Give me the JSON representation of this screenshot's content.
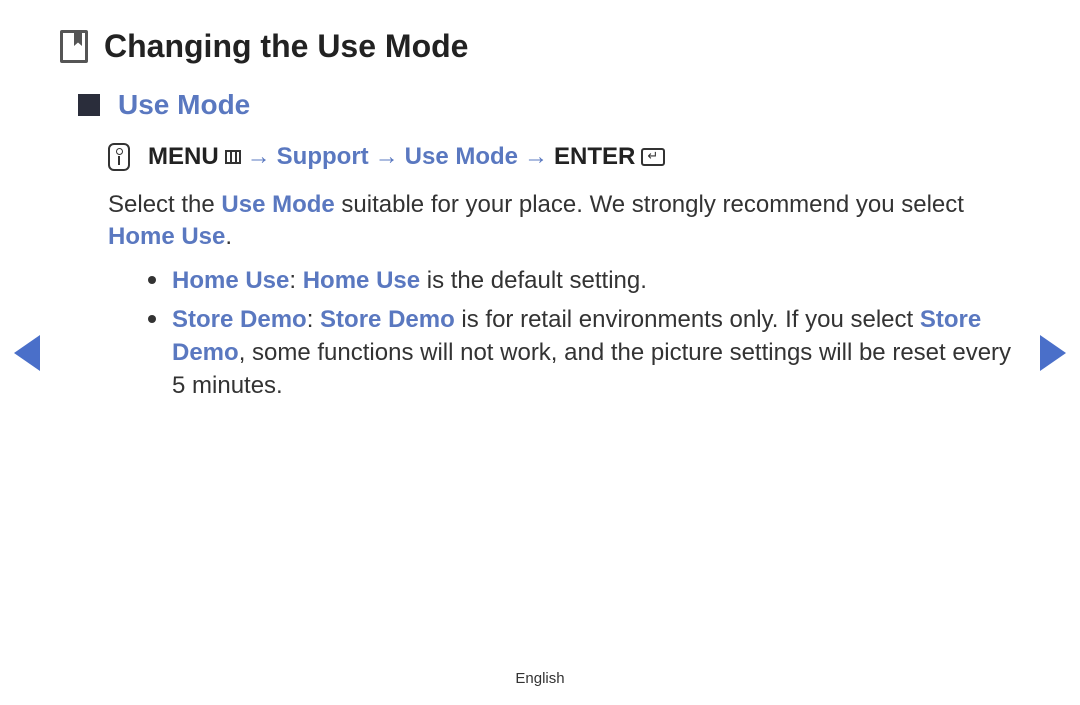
{
  "title": "Changing the Use Mode",
  "section": "Use Mode",
  "nav": {
    "menu": "MENU",
    "sep": "→",
    "support": "Support",
    "usemode": "Use Mode",
    "enter": "ENTER"
  },
  "intro": {
    "pre": "Select the ",
    "usemode": "Use Mode",
    "mid": " suitable for your place. We strongly recommend you select ",
    "homeuse": "Home Use",
    "end": "."
  },
  "bullets": {
    "home": {
      "label": "Home Use",
      "sep": ": ",
      "label2": "Home Use",
      "rest": " is the default setting."
    },
    "store": {
      "label": "Store Demo",
      "sep": ": ",
      "label2": "Store Demo",
      "mid": " is for retail environments only. If you select ",
      "label3": "Store Demo",
      "rest": ", some functions will not work, and the picture settings will be reset every 5 minutes."
    }
  },
  "footer": "English"
}
